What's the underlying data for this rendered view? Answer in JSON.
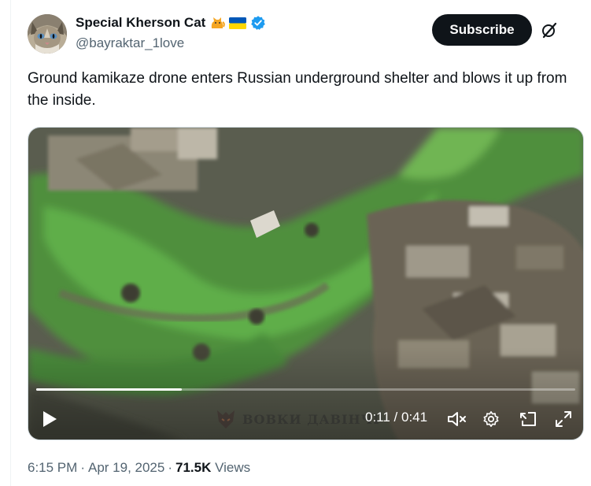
{
  "post": {
    "author": {
      "display_name": "Special Kherson Cat",
      "name_emojis": [
        "cat-icon",
        "ukraine-flag-icon"
      ],
      "handle": "@bayraktar_1love",
      "verified": true,
      "verified_color": "#1d9bf0"
    },
    "subscribe_label": "Subscribe",
    "grok_icon": "grok-icon",
    "text": "Ground kamikaze drone enters Russian underground shelter and blows it up from the inside.",
    "video": {
      "current_time": "0:11",
      "separator": " / ",
      "duration": "0:41",
      "progress_fraction": 0.27,
      "watermark_text": "ВОВКИ ДАВІНЧІ",
      "controls": [
        "play-icon",
        "mute-icon",
        "settings-icon",
        "pip-icon",
        "fullscreen-icon"
      ]
    },
    "meta": {
      "time": "6:15 PM",
      "date": "Apr 19, 2025",
      "views_count": "71.5K",
      "views_label": "Views"
    }
  }
}
